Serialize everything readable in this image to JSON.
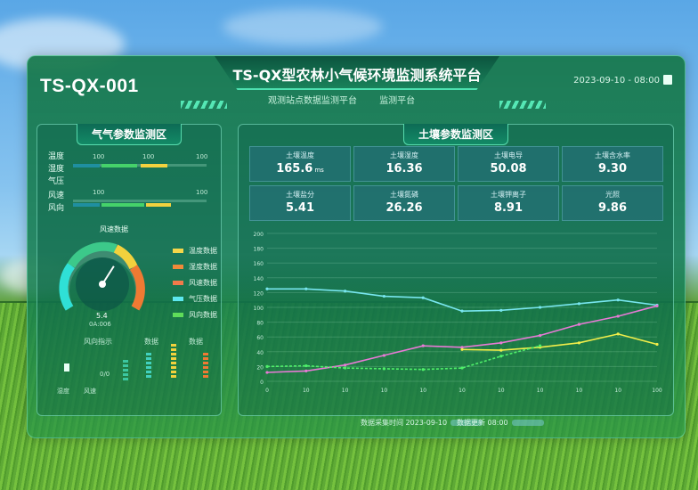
{
  "header": {
    "device_id": "TS-QX-001",
    "title": "TS-QX型农林小气候环境监测系统平台",
    "subtitle_items": [
      "观测站点数据监测平台",
      "监测平台"
    ],
    "datetime": "2023-09-10 - 08:00"
  },
  "left_panel": {
    "title": "气气参数监测区",
    "params": [
      {
        "label": "温度",
        "value_a": "100",
        "value_b": "100",
        "value_c": "100"
      },
      {
        "label": "湿度",
        "value_a": "",
        "value_b": "",
        "value_c": ""
      },
      {
        "label": "气压",
        "value_a": "",
        "value_b": "",
        "value_c": ""
      },
      {
        "label": "风速",
        "value_a": "100",
        "value_b": "",
        "value_c": "100"
      },
      {
        "label": "风向",
        "value_a": "",
        "value_b": "",
        "value_c": ""
      }
    ],
    "gauge": {
      "title": "风速数据",
      "reading": "5.4",
      "unit": "0A:006",
      "level": 0.62
    },
    "legend": [
      {
        "label": "温度数据",
        "color": "#f5d64a"
      },
      {
        "label": "湿度数据",
        "color": "#f08a3a"
      },
      {
        "label": "风速数据",
        "color": "#f07a4a"
      },
      {
        "label": "气压数据",
        "color": "#5ee8ef"
      },
      {
        "label": "风向数据",
        "color": "#5fdc5a"
      }
    ],
    "indicators": {
      "label_left": "风向指示",
      "label_mid": "数据",
      "label_right": "数据",
      "label_icon": "湿度",
      "label_icon2": "风速",
      "label_val": "0/0"
    }
  },
  "right_panel": {
    "title": "土壤参数监测区",
    "cells": [
      {
        "label": "土壤温度",
        "value": "165.6",
        "unit": "ms"
      },
      {
        "label": "土壤湿度",
        "value": "16.36",
        "unit": ""
      },
      {
        "label": "土壤电导",
        "value": "50.08",
        "unit": ""
      },
      {
        "label": "土壤含水率",
        "value": "9.30",
        "unit": ""
      },
      {
        "label": "土壤盐分",
        "value": "5.41",
        "unit": ""
      },
      {
        "label": "土壤氮磷",
        "value": "26.26",
        "unit": ""
      },
      {
        "label": "土壤钾离子",
        "value": "8.91",
        "unit": ""
      },
      {
        "label": "光照",
        "value": "9.86",
        "unit": ""
      }
    ],
    "footer_left": "数据采集时间 2023-09-10",
    "footer_right": "数据更新 08:00"
  },
  "chart_data": {
    "type": "line",
    "title": "",
    "ylabel": "",
    "ylim": [
      0,
      200
    ],
    "y_ticks": [
      "0",
      "20",
      "40",
      "60",
      "80",
      "100",
      "120",
      "140",
      "160",
      "180",
      "200"
    ],
    "x": [
      0,
      10,
      20,
      30,
      40,
      50,
      60,
      70,
      80,
      90,
      100
    ],
    "x_ticks": [
      "0",
      "10",
      "10",
      "10",
      "10",
      "10",
      "10",
      "10",
      "10",
      "10",
      "100"
    ],
    "series": [
      {
        "color": "#78e6ef",
        "values": [
          125,
          125,
          122,
          115,
          113,
          95,
          96,
          100,
          105,
          110,
          103
        ]
      },
      {
        "color": "#e87ad6",
        "values": [
          12,
          14,
          22,
          35,
          48,
          46,
          52,
          62,
          77,
          88,
          102
        ]
      },
      {
        "color": "#f2ee4a",
        "values": [
          null,
          null,
          null,
          null,
          null,
          43,
          42,
          46,
          52,
          64,
          50
        ]
      },
      {
        "color": "#4ff06a",
        "values": [
          20,
          21,
          18,
          17,
          16,
          18,
          34,
          48,
          null,
          null,
          null
        ]
      }
    ],
    "grid": true
  }
}
